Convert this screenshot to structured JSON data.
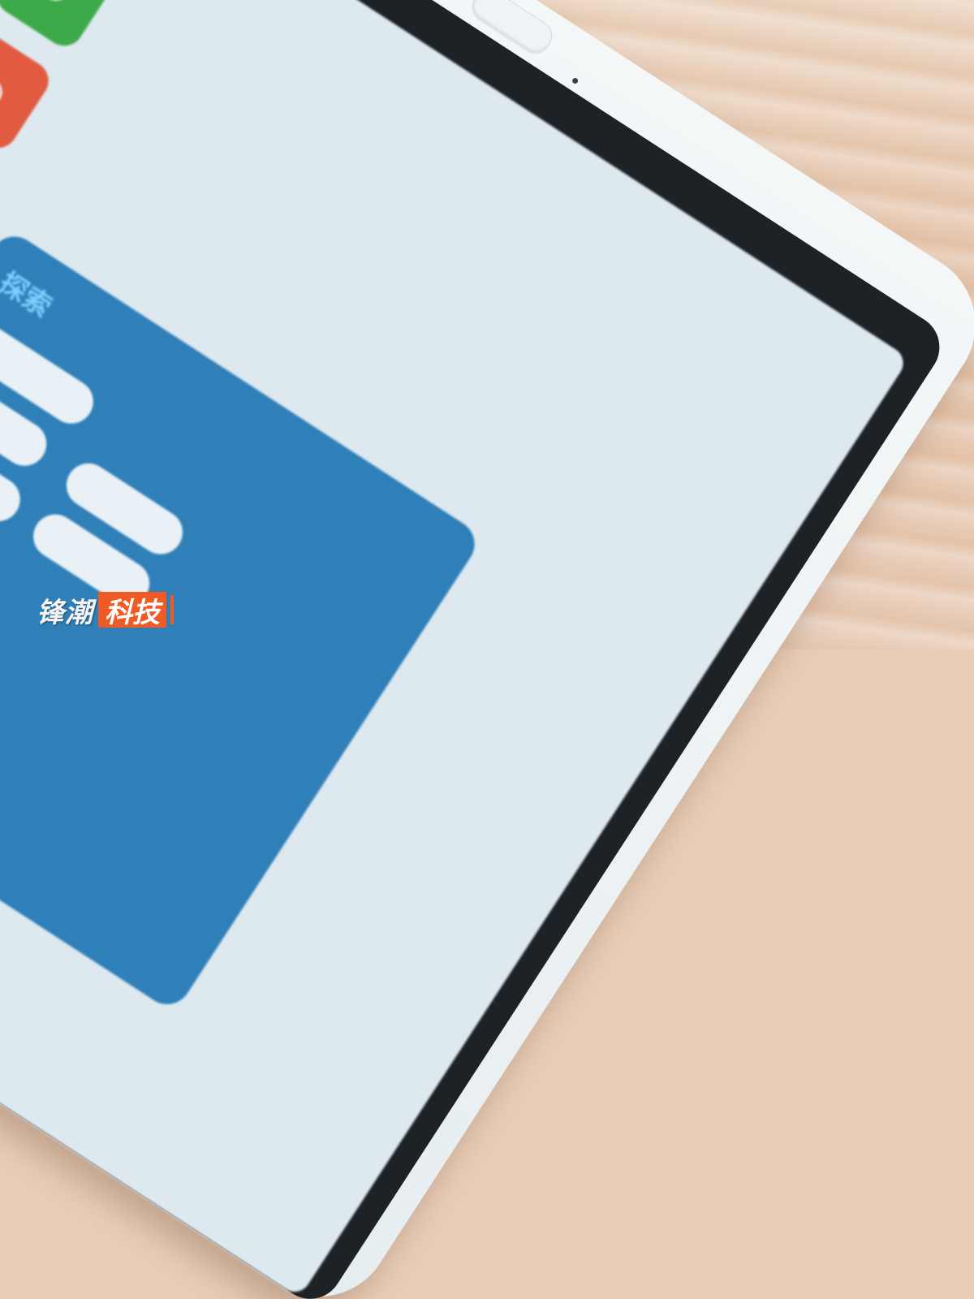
{
  "scene": {
    "subject": "white tablet top edge with hardware buttons on wooden table",
    "colors": {
      "wood": "#e9cdb6",
      "device_frame": "#eef3f5",
      "bezel": "#1d2226",
      "panel": "#2f7fb9",
      "watermark_accent": "#f05a24"
    }
  },
  "device": {
    "buttons": [
      "volume-up-button",
      "volume-down-button",
      "power-button"
    ],
    "icons": [
      "mijia-app-icon",
      "phone-app-icon",
      "settings-app-icon",
      "camera-app-icon",
      "message-app-icon",
      "photos-app-icon"
    ]
  },
  "screen": {
    "panel_title": "探索",
    "chips": [
      "",
      "",
      "",
      "",
      "",
      "",
      ""
    ]
  },
  "watermark": {
    "part1": "锋潮",
    "part2": "科技"
  }
}
